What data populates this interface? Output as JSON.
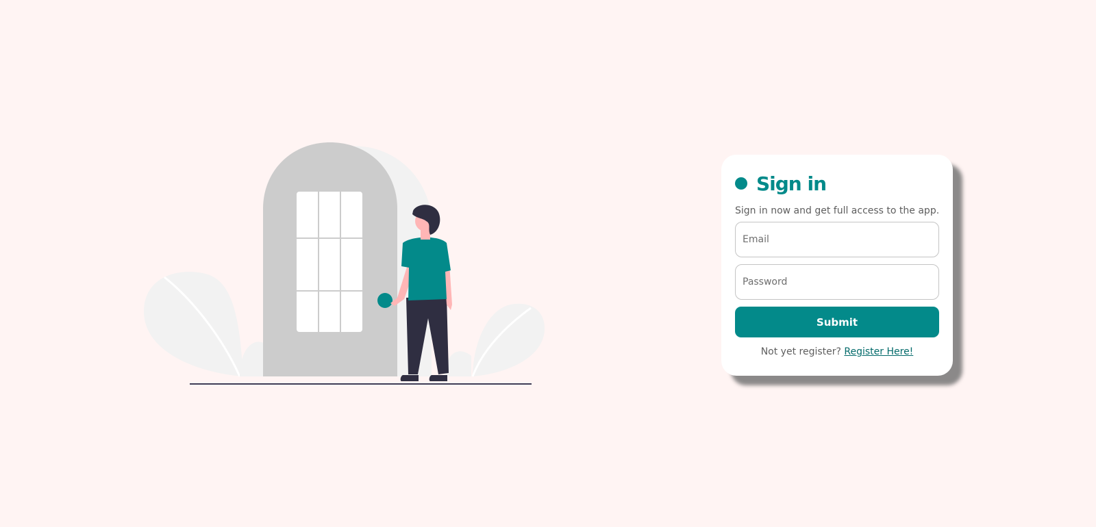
{
  "login_card": {
    "title": "Sign in",
    "subtitle": "Sign in now and get full access to the app.",
    "email_placeholder": "Email",
    "password_placeholder": "Password",
    "submit_label": "Submit",
    "register_prompt": "Not yet register?",
    "register_link": "Register Here!"
  },
  "illustration": {
    "icon": "person-at-door-illustration"
  },
  "colors": {
    "background": "#fff4f3",
    "accent": "#038a8a",
    "door": "#cccccc",
    "foliage": "#f2f2f2",
    "pants": "#2f2e41",
    "skin": "#ffb6b6"
  }
}
